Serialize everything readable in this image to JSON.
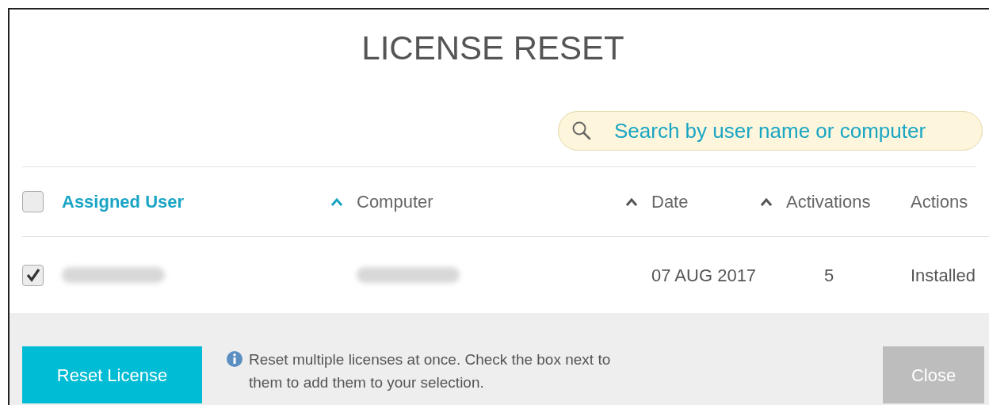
{
  "dialog": {
    "title": "LICENSE RESET"
  },
  "search": {
    "placeholder": "Search by user name or computer"
  },
  "select_all": {
    "checked": false
  },
  "columns": [
    {
      "label": "Assigned User",
      "selected": true,
      "sortable": true
    },
    {
      "label": "Computer",
      "selected": false,
      "sortable": true
    },
    {
      "label": "Date",
      "selected": false,
      "sortable": true
    },
    {
      "label": "Activations",
      "selected": false,
      "sortable": false
    },
    {
      "label": "Actions",
      "selected": false,
      "sortable": false
    }
  ],
  "rows": [
    {
      "checked": true,
      "date": "07 AUG 2017",
      "activations": "5",
      "action": "Installed"
    }
  ],
  "footer": {
    "primary_button": "Reset License",
    "info": "Reset multiple licenses at once. Check the box next to them to add them to your selection.",
    "close_button": "Close"
  }
}
